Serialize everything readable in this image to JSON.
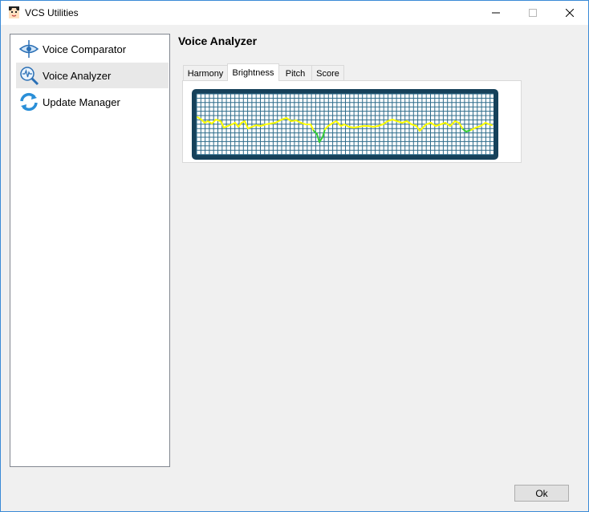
{
  "window": {
    "title": "VCS Utilities"
  },
  "sidebar": {
    "items": [
      {
        "label": "Voice Comparator",
        "icon": "voice-comparator-icon"
      },
      {
        "label": "Voice Analyzer",
        "icon": "voice-analyzer-icon"
      },
      {
        "label": "Update Manager",
        "icon": "update-manager-icon"
      }
    ],
    "selected": "Voice Analyzer"
  },
  "main": {
    "heading": "Voice Analyzer",
    "tabs": [
      {
        "label": "Harmony"
      },
      {
        "label": "Brightness"
      },
      {
        "label": "Pitch"
      },
      {
        "label": "Score"
      }
    ],
    "active_tab": "Brightness"
  },
  "footer": {
    "ok_label": "Ok"
  },
  "colors": {
    "scope_frame": "#16415a",
    "scope_bg": "#ffffff",
    "grid_line": "#2d6b8a",
    "trace_high": "#ffff00",
    "trace_low": "#33cc33"
  }
}
